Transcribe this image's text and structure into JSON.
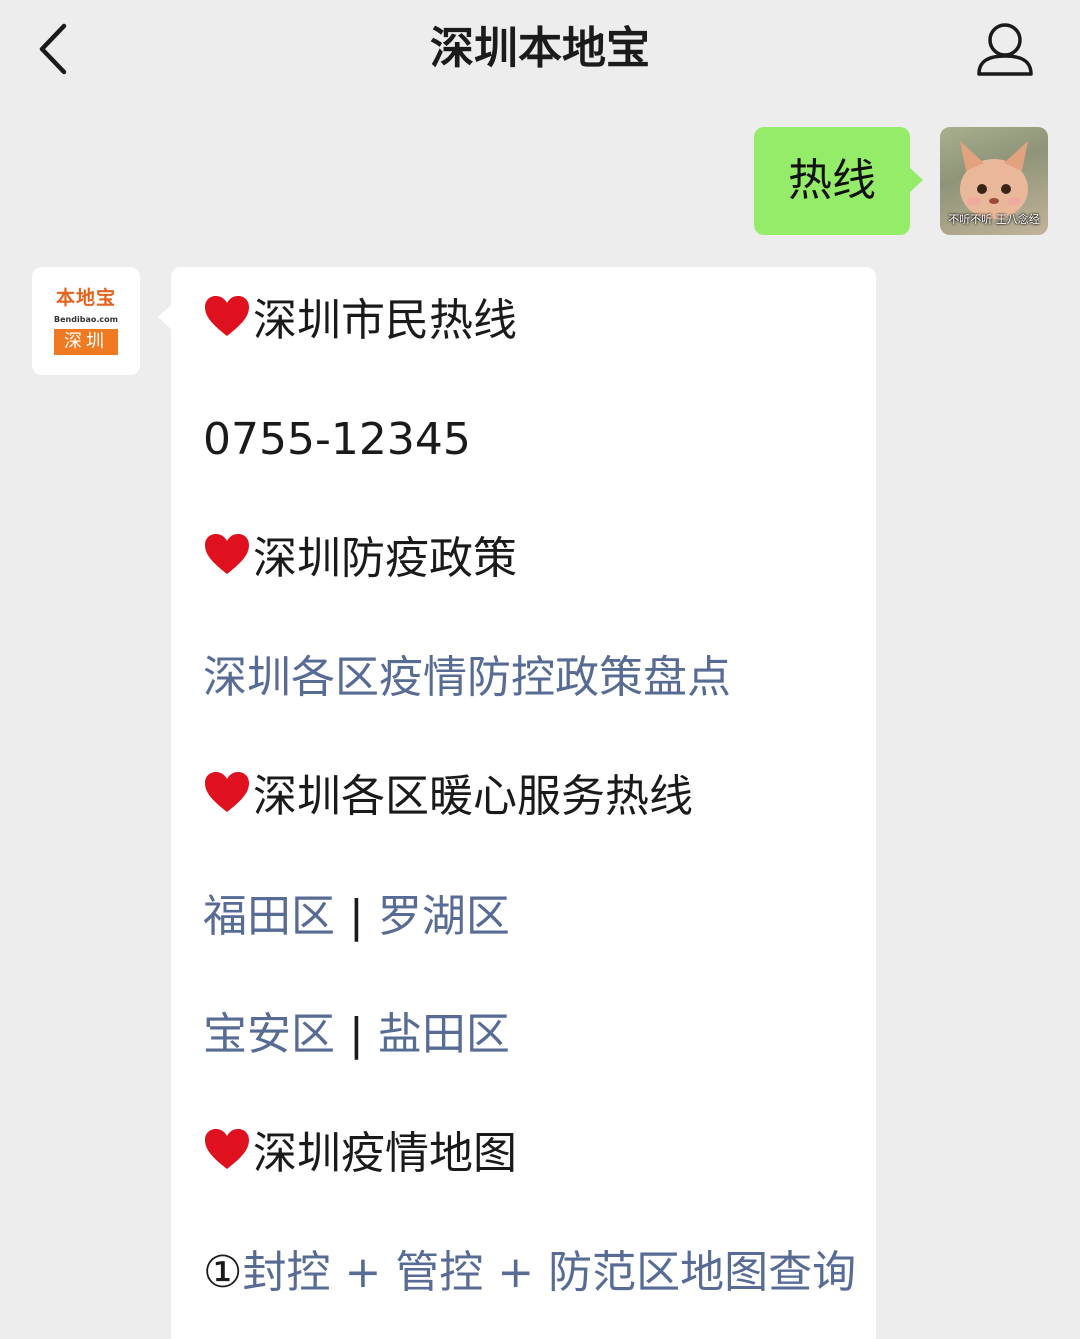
{
  "header": {
    "title": "深圳本地宝"
  },
  "chat": {
    "outgoing_text": "热线",
    "user_avatar_caption": "不听不听 王八念经",
    "bot_logo": {
      "main": "本地宝",
      "sub": "Bendibao.com",
      "tag": "深圳"
    },
    "message_lines": [
      {
        "kind": "heading",
        "text": "深圳市民热线"
      },
      {
        "kind": "text",
        "text": "0755-12345"
      },
      {
        "kind": "heading",
        "text": "深圳防疫政策"
      },
      {
        "kind": "link",
        "text": "深圳各区疫情防控政策盘点"
      },
      {
        "kind": "heading",
        "text": "深圳各区暖心服务热线"
      },
      {
        "kind": "links",
        "left": "福田区",
        "sep": "|",
        "right": "罗湖区"
      },
      {
        "kind": "links",
        "left": "宝安区",
        "sep": "|",
        "right": "盐田区"
      },
      {
        "kind": "heading",
        "text": "深圳疫情地图"
      },
      {
        "kind": "numbered-link",
        "num": "①",
        "text": "封控 + 管控 + 防范区地图查询"
      }
    ]
  },
  "colors": {
    "background": "#ededed",
    "outgoing_bubble": "#95ec69",
    "incoming_bubble": "#ffffff",
    "link": "#576b95",
    "heart": "#e0111f"
  },
  "icons": [
    "back-chevron-icon",
    "person-icon",
    "heart-icon"
  ]
}
